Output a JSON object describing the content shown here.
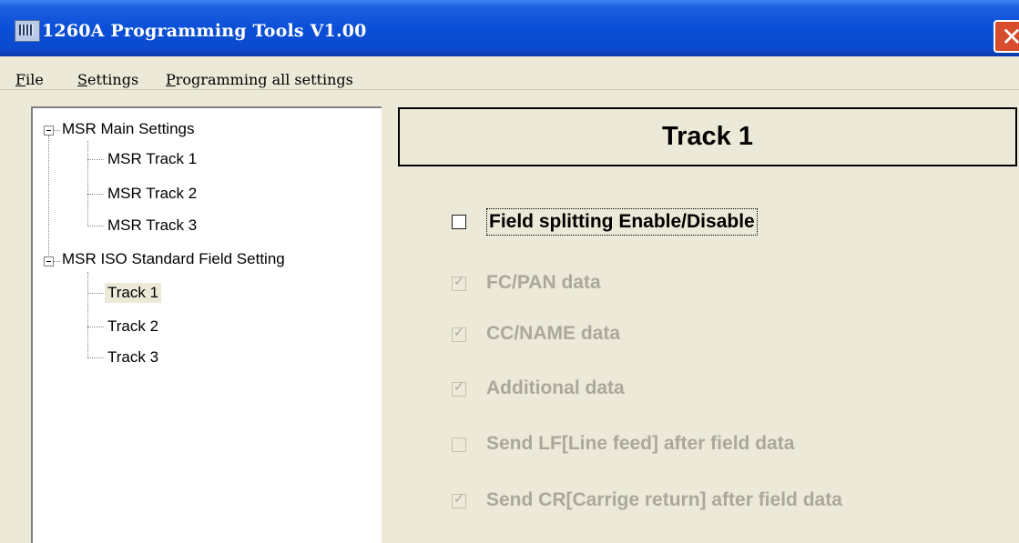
{
  "window": {
    "title": "1260A Programming Tools V1.00",
    "close_glyph": "✕"
  },
  "menu": [
    {
      "key": "F",
      "rest": "ile"
    },
    {
      "key": "S",
      "rest": "ettings"
    },
    {
      "key": "P",
      "rest": "rogramming all settings"
    }
  ],
  "tree": {
    "group1": {
      "label": "MSR Main Settings",
      "expanded": true,
      "children": [
        "MSR Track 1",
        "MSR Track 2",
        "MSR Track 3"
      ]
    },
    "group2": {
      "label": "MSR ISO Standard Field Setting",
      "expanded": true,
      "children": [
        "Track 1",
        "Track 2",
        "Track 3"
      ]
    },
    "selected": "Track 1"
  },
  "panel": {
    "header": "Track 1",
    "options": [
      {
        "label": "Field splitting Enable/Disable",
        "checked": false,
        "enabled": true
      },
      {
        "label": "FC/PAN data",
        "checked": true,
        "enabled": false
      },
      {
        "label": "CC/NAME data",
        "checked": true,
        "enabled": false
      },
      {
        "label": "Additional data",
        "checked": true,
        "enabled": false
      },
      {
        "label": "Send LF[Line feed] after field data",
        "checked": false,
        "enabled": false
      },
      {
        "label": "Send CR[Carrige return] after field data",
        "checked": true,
        "enabled": false
      }
    ]
  },
  "icons": {
    "check": "check-mark-icon",
    "app": "app-icon",
    "close": "close-icon"
  }
}
